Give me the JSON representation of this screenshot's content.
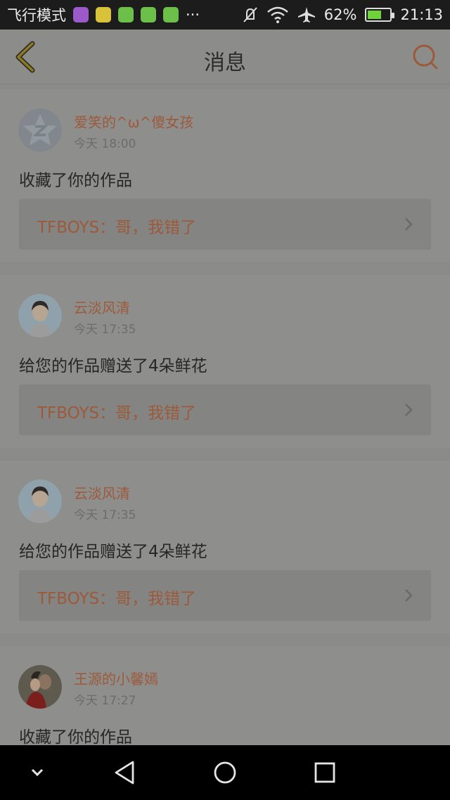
{
  "status_bar": {
    "left_text": "飞行模式",
    "more": "···",
    "battery_pct": "62%",
    "time": "21:13",
    "battery_level": 0.62,
    "app_icons": [
      "gallery-icon",
      "app-icon",
      "app-icon",
      "app-icon",
      "app-icon"
    ],
    "icons": [
      "mute-icon",
      "wifi-icon",
      "airplane-icon",
      "battery-icon"
    ]
  },
  "header": {
    "title": "消息",
    "icons": [
      "back-icon",
      "search-icon"
    ]
  },
  "messages": [
    {
      "name": "爱笑的^ω^傻女孩",
      "time": "今天 18:00",
      "action": "收藏了你的作品",
      "work": "TFBOYS：哥，我错了",
      "avatar": "default-avatar-icon"
    },
    {
      "name": "云淡风清",
      "time": "今天 17:35",
      "action": "给您的作品赠送了4朵鲜花",
      "work": "TFBOYS：哥，我错了",
      "avatar": "user-avatar-icon"
    },
    {
      "name": "云淡风清",
      "time": "今天 17:35",
      "action": "给您的作品赠送了4朵鲜花",
      "work": "TFBOYS：哥，我错了",
      "avatar": "user-avatar-icon"
    },
    {
      "name": "王源的小馨嫣",
      "time": "今天 17:27",
      "action": "收藏了你的作品",
      "work": "",
      "avatar": "user-photo-avatar-icon"
    }
  ],
  "nav_bar": {
    "icons": [
      "hide-icon",
      "back-triangle-icon",
      "home-circle-icon",
      "recents-square-icon"
    ]
  },
  "colors": {
    "accent": "#9c5a3a",
    "background": "#8a8a89",
    "status_bar": "#1c1c1c",
    "nav_bar": "#000000"
  }
}
